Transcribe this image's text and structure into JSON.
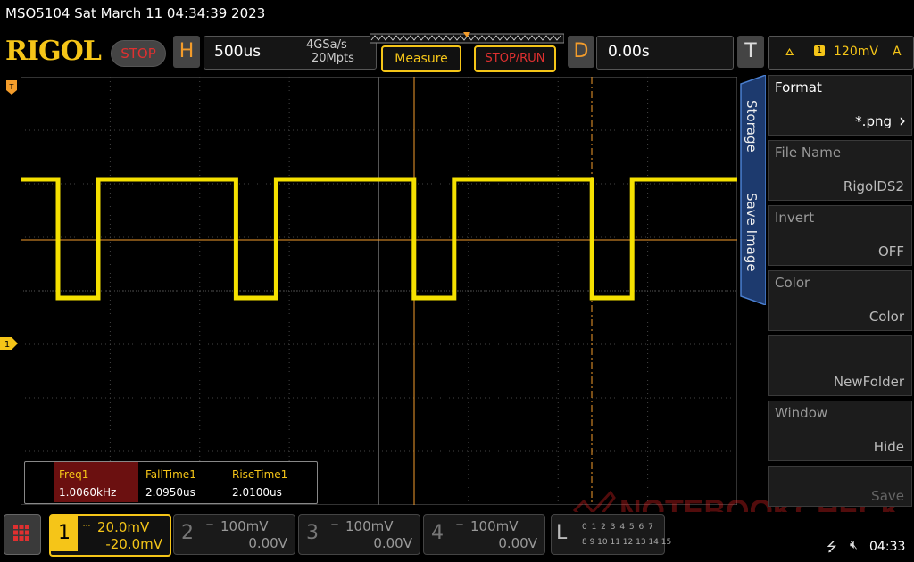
{
  "header": {
    "title": "MSO5104  Sat March 11 04:34:39 2023",
    "brand": "RIGOL",
    "run_state": "STOP",
    "horizontal": {
      "letter": "H",
      "timebase": "500us",
      "sample_rate": "4GSa/s",
      "memory_depth": "20Mpts"
    },
    "measure_label": "Measure",
    "stop_run_label": "STOP/RUN",
    "delay": {
      "letter": "D",
      "value": "0.00s"
    },
    "trigger": {
      "letter": "T",
      "channel": "1",
      "level": "120mV",
      "mode": "A"
    }
  },
  "waveform": {
    "trace_color": "#f5e000",
    "cursor_color": "#f39c2b",
    "channel_marker": "1",
    "trigger_marker_icon": "trigger-t-icon"
  },
  "measurements": [
    {
      "label": "Freq1",
      "value": "1.0060kHz",
      "highlight": true
    },
    {
      "label": "FallTime1",
      "value": "2.0950us",
      "highlight": false
    },
    {
      "label": "RiseTime1",
      "value": "2.0100us",
      "highlight": false
    }
  ],
  "sidebar": {
    "tabs": [
      "Storage",
      "Save Image"
    ],
    "items": [
      {
        "label": "Format",
        "value": "*.png",
        "has_arrow": true
      },
      {
        "label": "File Name",
        "value": "RigolDS2"
      },
      {
        "label": "Invert",
        "value": "OFF"
      },
      {
        "label": "Color",
        "value": "Color"
      },
      {
        "label": "",
        "value": "NewFolder"
      },
      {
        "label": "Window",
        "value": "Hide"
      },
      {
        "label": "",
        "value": "Save"
      }
    ]
  },
  "channels": [
    {
      "num": "1",
      "scale": "20.0mV",
      "offset": "-20.0mV",
      "active": true
    },
    {
      "num": "2",
      "scale": "100mV",
      "offset": "0.00V",
      "active": false
    },
    {
      "num": "3",
      "scale": "100mV",
      "offset": "0.00V",
      "active": false
    },
    {
      "num": "4",
      "scale": "100mV",
      "offset": "0.00V",
      "active": false
    }
  ],
  "logic": {
    "letter": "L",
    "row1": "0 1 2 3 4 5 6 7",
    "row2": "8 9 10 11 12 13 14 15"
  },
  "status": {
    "clock": "04:33"
  },
  "watermark": "NOTEBOOKCHECK",
  "colors": {
    "accent": "#f5c518",
    "stop": "#e03030",
    "orange": "#f39c2b"
  }
}
